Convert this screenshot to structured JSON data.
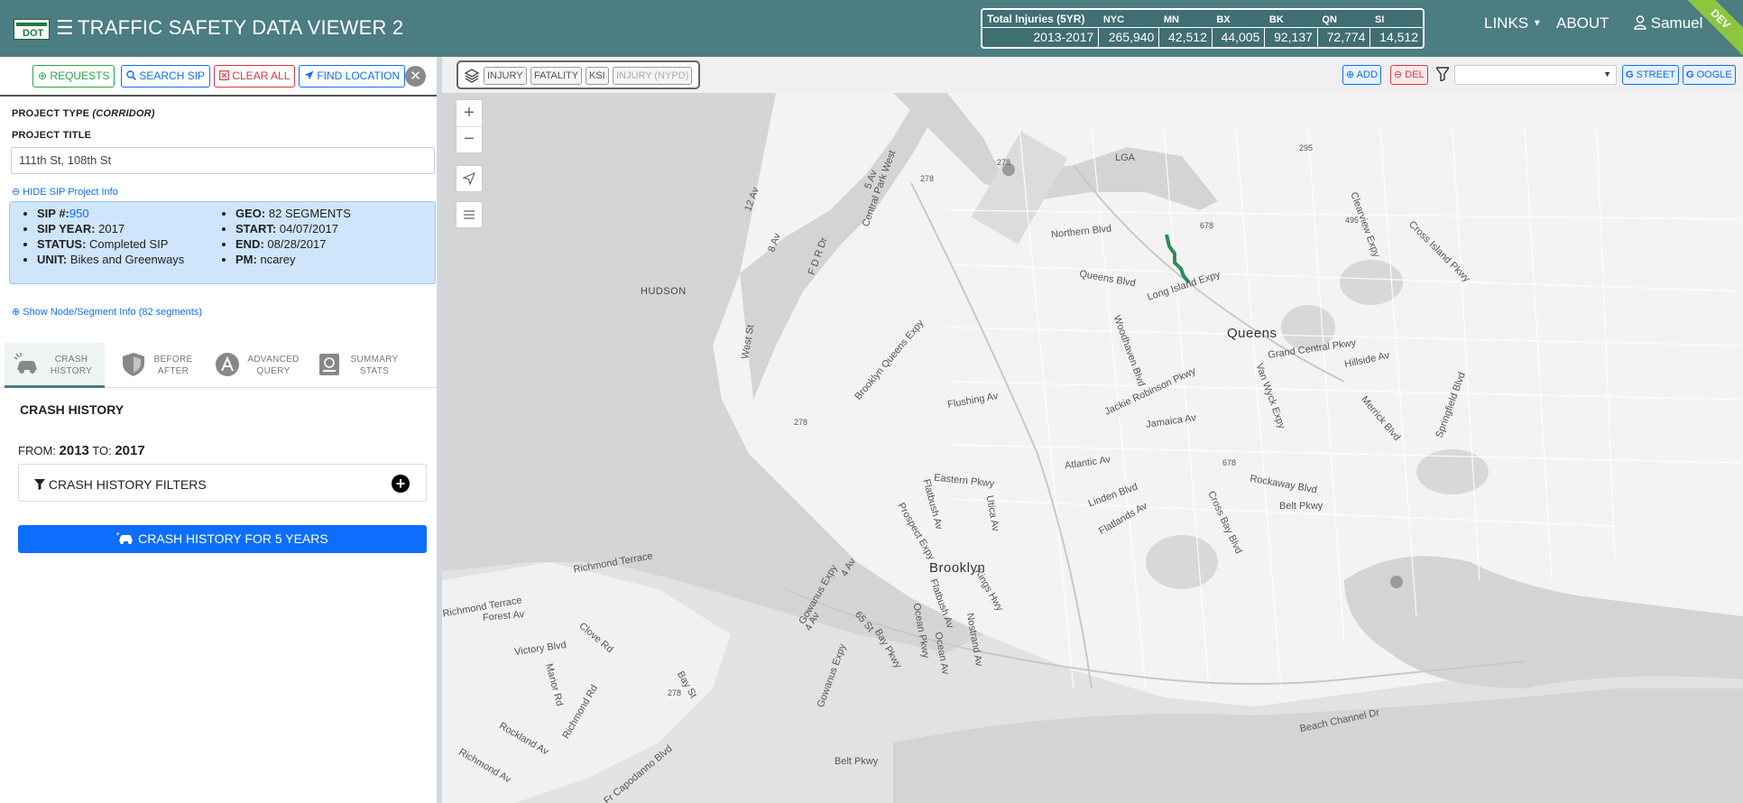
{
  "header": {
    "title": "TRAFFIC SAFETY DATA VIEWER 2",
    "hamburger": "☰",
    "logo_text": "DOT",
    "links_label": "LINKS",
    "about_label": "ABOUT",
    "user_label": "Samuel",
    "dev_badge": "DEV",
    "stats": {
      "caption": "Total Injuries (5YR)",
      "range": "2013-2017",
      "columns": [
        "NYC",
        "MN",
        "BX",
        "BK",
        "QN",
        "SI"
      ],
      "values": [
        "265,940",
        "42,512",
        "44,005",
        "92,137",
        "72,774",
        "14,512"
      ]
    }
  },
  "left_toolbar": {
    "requests": "REQUESTS",
    "search_sip": "SEARCH SIP",
    "clear_all": "CLEAR ALL",
    "find_location": "FIND LOCATION",
    "close": "✕"
  },
  "project": {
    "type_label": "PROJECT TYPE",
    "type_value": "(CORRIDOR)",
    "title_label": "PROJECT TITLE",
    "title_value": "111th St, 108th St",
    "hide_info_label": "HIDE SIP Project Info",
    "node_info_label": "Show Node/Segment Info (82 segments)",
    "info_left": [
      {
        "key": "SIP #:",
        "value": "950",
        "link": true
      },
      {
        "key": "SIP YEAR:",
        "value": "2017"
      },
      {
        "key": "STATUS:",
        "value": "Completed SIP"
      },
      {
        "key": "UNIT:",
        "value": "Bikes and Greenways"
      }
    ],
    "info_right": [
      {
        "key": "GEO:",
        "value": "82 SEGMENTS"
      },
      {
        "key": "START:",
        "value": "04/07/2017"
      },
      {
        "key": "END:",
        "value": "08/28/2017"
      },
      {
        "key": "PM:",
        "value": "ncarey"
      }
    ]
  },
  "tabs": [
    {
      "line1": "CRASH",
      "line2": "HISTORY",
      "active": true
    },
    {
      "line1": "BEFORE",
      "line2": "AFTER"
    },
    {
      "line1": "ADVANCED",
      "line2": "QUERY"
    },
    {
      "line1": "SUMMARY",
      "line2": "STATS"
    }
  ],
  "crash_history": {
    "title": "CRASH HISTORY",
    "from_label": "FROM:",
    "from_value": "2013",
    "to_label": "TO:",
    "to_value": "2017",
    "filters_label": "CRASH HISTORY FILTERS",
    "button_label": "CRASH HISTORY FOR 5 YEARS"
  },
  "map_toolbar": {
    "layers": [
      "INJURY",
      "FATALITY",
      "KSI",
      "INJURY (NYPD)"
    ],
    "add": "ADD",
    "del": "DEL",
    "select_value": "",
    "street": "STREET",
    "google": "OOGLE"
  },
  "map": {
    "labels": {
      "hudson": "HUDSON",
      "queens": "Queens",
      "brooklyn": "Brooklyn",
      "lga": "LGA",
      "northern_blvd": "Northern Blvd",
      "queens_blvd": "Queens Blvd",
      "long_island_expy": "Long Island Expy",
      "grand_central_pkwy": "Grand Central Pkwy",
      "hillside_av": "Hillside Av",
      "jamaica_av": "Jamaica Av",
      "atlantic_av": "Atlantic Av",
      "eastern_pkwy": "Eastern Pkwy",
      "flatbush_av": "Flatbush Av",
      "rockaway_blvd": "Rockaway Blvd",
      "belt_pkwy_1": "Belt Pkwy",
      "belt_pkwy_2": "Belt Pkwy",
      "linden_blvd": "Linden Blvd",
      "flatlands_av": "Flatlands Av",
      "utica_av": "Utica Av",
      "ocean_pkwy": "Ocean Pkwy",
      "flushing_av": "Flushing Av",
      "woodhaven_blvd": "Woodhaven Blvd",
      "van_wyck": "Van Wyck Expy",
      "cross_bay_blvd": "Cross Bay Blvd",
      "beach_channel_dr": "Beach Channel Dr",
      "richmond_terrace": "Richmond Terrace",
      "victory_blvd": "Victory Blvd",
      "forest_av": "Forest Av",
      "clove_rd": "Clove Rd",
      "bay_pkwy": "Bay Pkwy",
      "fourth_av": "4 Av",
      "sixtyfifth_st": "65 St",
      "bqe": "Brooklyn Queens Expy",
      "prospect_expy": "Prospect Expy",
      "cross_island_pkwy": "Cross Island Pkwy",
      "clearview_expy": "Clearview Expy",
      "springfield_blvd": "Springfield Blvd",
      "merrick_blvd": "Merrick Blvd",
      "jackie_robinson_pkwy": "Jackie Robinson Pkwy",
      "fdr_dr": "F D R Dr",
      "west_st": "West St",
      "kings_hwy": "Kings Hwy",
      "nostrand_av": "Nostrand Av",
      "ocean_av": "Ocean Av",
      "flatbush_av2": "Flatbush Av",
      "gowanus_expy": "Gowanus Expy",
      "eighth_av": "8 Av",
      "fifth_av": "5 Av",
      "twelfth_av": "12 Av",
      "central_park_west": "Central Park West",
      "rockland_av": "Rockland Av",
      "richmond_rd": "Richmond Rd",
      "richmond_av": "Richmond Av",
      "richmond_terrace2": "Richmond Terrace",
      "manor_rd": "Manor Rd",
      "father_capodanno_blvd": "Fr Capodanno Blvd",
      "bay_st": "Bay St",
      "fourth_av2": "4 Av",
      "gowanus_expy2": "Gowanus Expy",
      "route_278a": "278",
      "route_278b": "278",
      "route_278c": "278",
      "route_278d": "278",
      "route_678a": "678",
      "route_678b": "678",
      "route_295": "295",
      "route_495": "495"
    }
  }
}
